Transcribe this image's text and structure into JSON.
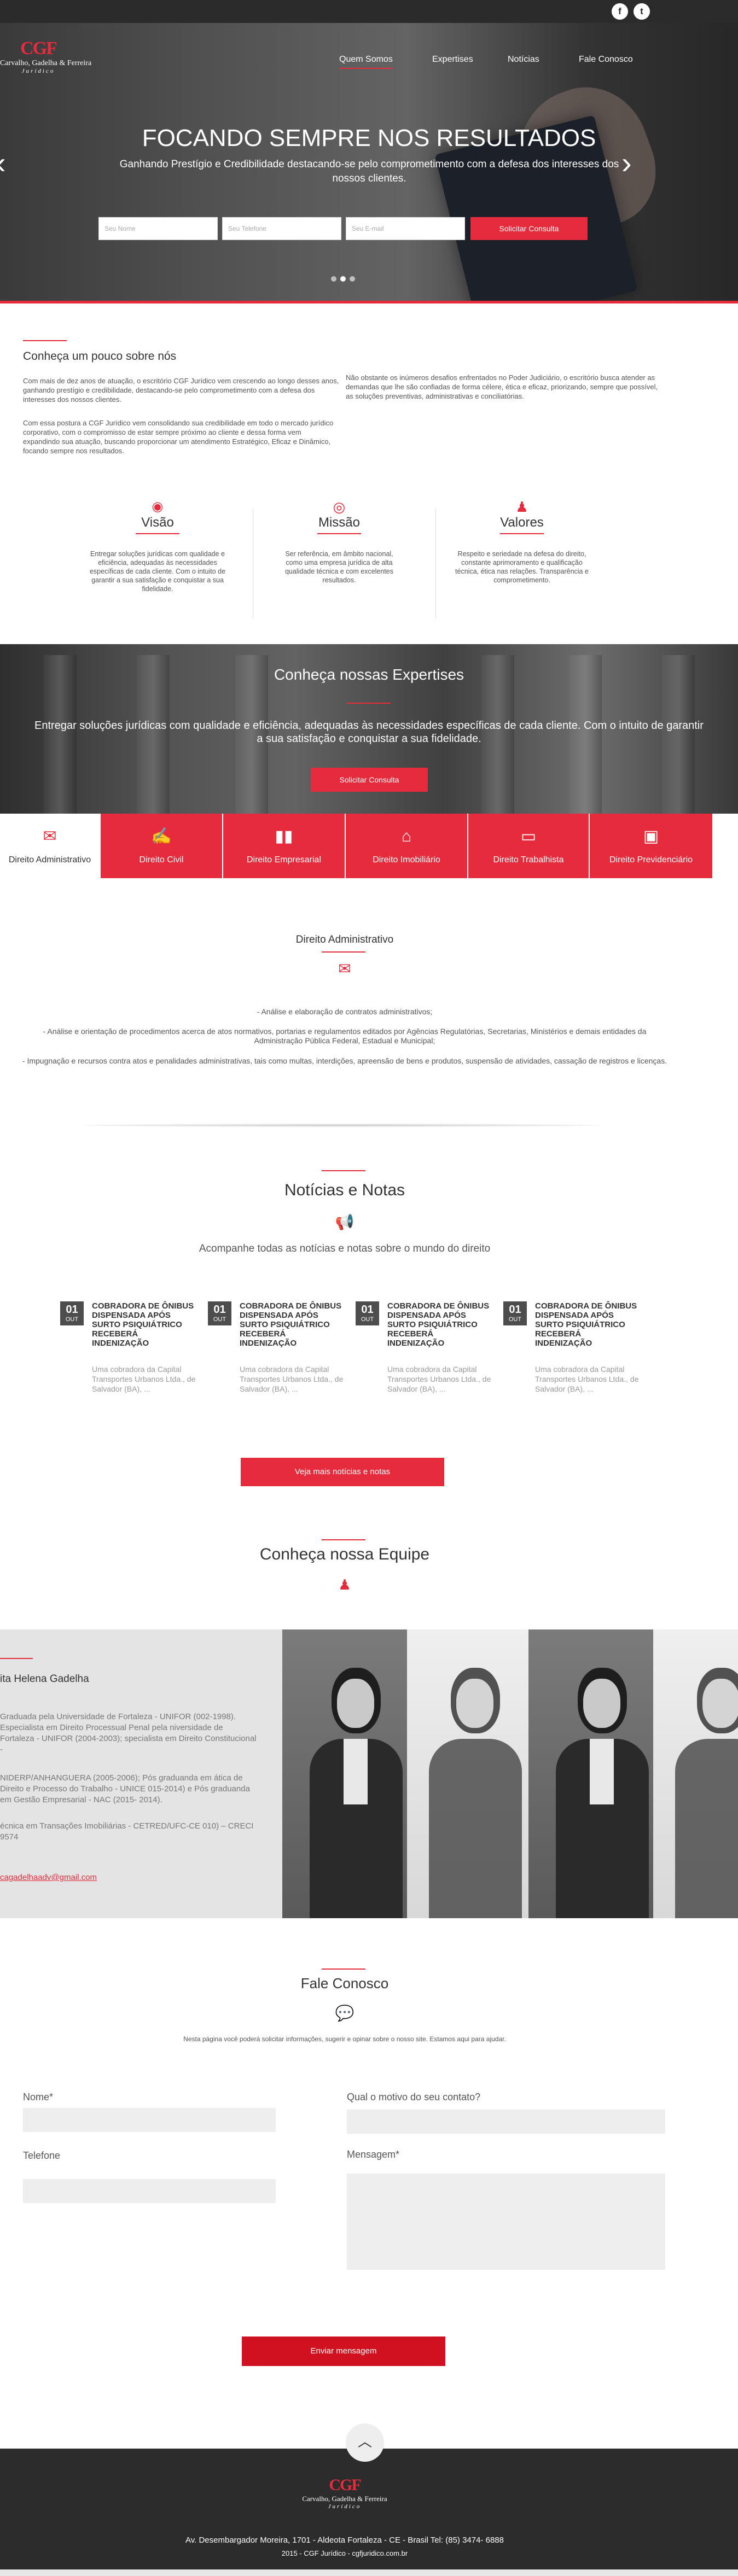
{
  "header": {
    "logo": {
      "mark": "CGF",
      "name": "Carvalho, Gadelha & Ferreira",
      "sub": "Jurídico"
    },
    "nav": [
      {
        "label": "Quem Somos",
        "active": true
      },
      {
        "label": "Expertises"
      },
      {
        "label": "Notícias"
      },
      {
        "label": "Fale Conosco"
      }
    ],
    "social": [
      {
        "icon": "facebook-icon",
        "glyph": "f"
      },
      {
        "icon": "twitter-icon",
        "glyph": "t"
      }
    ]
  },
  "hero": {
    "title": "FOCANDO SEMPRE NOS RESULTADOS",
    "subtitle": "Ganhando Prestígio e Credibilidade destacando-se pelo comprometimento com a defesa dos interesses dos nossos clientes.",
    "form": {
      "name_placeholder": "Seu Nome",
      "phone_placeholder": "Seu Telefone",
      "email_placeholder": "Seu E-mail",
      "submit": "Solicitar Consulta"
    },
    "slides": 3,
    "active_slide": 2
  },
  "about": {
    "title": "Conheça um pouco sobre nós",
    "p1": "Com mais de dez anos de atuação, o escritório CGF Jurídico vem crescendo ao longo desses anos, ganhando prestígio e credibilidade, destacando-se pelo comprometimento com a defesa dos interesses dos nossos clientes.",
    "p2": "Com essa postura a CGF Jurídico vem consolidando sua credibilidade em todo o mercado jurídico corporativo, com o compromisso de estar sempre próximo ao cliente e dessa forma vem expandindo sua atuação, buscando proporcionar um atendimento Estratégico, Eficaz e Dinâmico, focando sempre nos resultados.",
    "p3": "Não obstante os inúmeros desafios enfrentados no Poder Judiciário, o escritório busca atender as demandas que lhe são confiadas de forma célere, ética e eficaz, priorizando, sempre que possível, as soluções preventivas, administrativas e conciliatórias.",
    "pillars": [
      {
        "icon": "eye-icon",
        "glyph": "◉",
        "title": "Visão",
        "text": "Entregar soluções jurídicas com qualidade e eficiência, adequadas às necessidades específicas de cada cliente. Com o intuito de garantir a sua satisfação e conquistar a sua fidelidade."
      },
      {
        "icon": "target-icon",
        "glyph": "◎",
        "title": "Missão",
        "text": "Ser referência, em âmbito nacional, como uma empresa jurídica de alta qualidade técnica e com excelentes resultados."
      },
      {
        "icon": "people-icon",
        "glyph": "♟",
        "title": "Valores",
        "text": "Respeito e seriedade na defesa do direito, constante aprimoramento e qualificação técnica, ética nas relações. Transparência e comprometimento."
      }
    ]
  },
  "expertise": {
    "title": "Conheça nossas Expertises",
    "text": "Entregar soluções jurídicas com qualidade e eficiência, adequadas às necessidades específicas de cada cliente. Com o intuito de garantir a sua satisfação e conquistar a sua  fidelidade.",
    "cta": "Solicitar Consulta",
    "tabs": [
      {
        "label": "Direito Administrativo",
        "glyph": "✉",
        "icon": "inbox-icon",
        "selected": true
      },
      {
        "label": "Direito Civil",
        "glyph": "✍",
        "icon": "handshake-icon"
      },
      {
        "label": "Direito Empresarial",
        "glyph": "▮▮",
        "icon": "building-icon"
      },
      {
        "label": "Direito Imobiliário",
        "glyph": "⌂",
        "icon": "house-icon"
      },
      {
        "label": "Direito Trabalhista",
        "glyph": "▭",
        "icon": "briefcase-icon"
      },
      {
        "label": "Direito Previdenciário",
        "glyph": "▣",
        "icon": "document-icon"
      }
    ],
    "detail": {
      "title": "Direito Administrativo",
      "lines": [
        "- Análise e elaboração de contratos administrativos;",
        "- Análise e orientação de procedimentos acerca de atos normativos,  portarias e regulamentos editados por Agências Regulatórias, Secretarias,  Ministérios e demais entidades da Administração Pública Federal, Estadual e Municipal;",
        "- Impugnação e recursos contra atos e penalidades administrativas, tais como multas, interdições, apreensão de bens e produtos, suspensão de atividades, cassação de registros e licenças."
      ]
    }
  },
  "news": {
    "title": "Notícias e Notas",
    "subtitle": "Acompanhe todas as notícias e notas sobre o mundo do direito",
    "items": [
      {
        "day": "01",
        "month": "OUT",
        "title": "COBRADORA DE ÔNIBUS DISPENSADA APÓS SURTO PSIQUIÁTRICO RECEBERÁ INDENIZAÇÃO",
        "body": "Uma cobradora da Capital Transportes Urbanos Ltda., de Salvador (BA), ..."
      },
      {
        "day": "01",
        "month": "OUT",
        "title": "COBRADORA DE ÔNIBUS DISPENSADA APÓS SURTO PSIQUIÁTRICO RECEBERÁ INDENIZAÇÃO",
        "body": "Uma cobradora da Capital Transportes Urbanos Ltda., de Salvador (BA), ..."
      },
      {
        "day": "01",
        "month": "OUT",
        "title": "COBRADORA DE ÔNIBUS DISPENSADA APÓS SURTO PSIQUIÁTRICO RECEBERÁ INDENIZAÇÃO",
        "body": "Uma cobradora da Capital Transportes Urbanos Ltda., de Salvador (BA), ..."
      },
      {
        "day": "01",
        "month": "OUT",
        "title": "COBRADORA DE ÔNIBUS DISPENSADA APÓS SURTO PSIQUIÁTRICO RECEBERÁ INDENIZAÇÃO",
        "body": "Uma cobradora da Capital Transportes Urbanos Ltda., de Salvador (BA), ..."
      }
    ],
    "more": "Veja  mais notícias e notas"
  },
  "team": {
    "title": "Conheça nossa Equipe",
    "member": {
      "name": "ita Helena Gadelha",
      "bio1": "Graduada pela Universidade de Fortaleza - UNIFOR (002-1998). Especialista em Direito  Processual Penal pela niversidade de Fortaleza - UNIFOR (2004-2003); specialista em Direito Constitucional -",
      "bio2": "NIDERP/ANHANGUERA (2005-2006); Pós graduanda em ática de Direito e Processo do Trabalho - UNICE 015-2014) e Pós graduanda em Gestão Empresarial - NAC (2015- 2014).",
      "bio3": "écnica em Transações Imobiliárias - CETRED/UFC-CE 010) – CRECI 9574",
      "email": "cagadelhaadv@gmail.com"
    }
  },
  "contact": {
    "title": "Fale Conosco",
    "intro": "Nesta página você poderá solicitar informações, sugerir e opinar sobre o nosso site. Estamos aqui para ajudar.",
    "name_label": "Nome*",
    "phone_label": "Telefone",
    "reason_label": "Qual o motivo do seu contato?",
    "message_label": "Mensagem*",
    "submit": "Enviar mensagem"
  },
  "footer": {
    "address": "Av. Desembargador Moreira, 1701 - Aldeota Fortaleza - CE - Brasil Tel: (85) 3474- 6888",
    "copyright": "2015 - CGF Jurídico - cgfjuridico.com.br"
  },
  "colors": {
    "accent": "#e52b3c",
    "dark": "#2b2b2b"
  }
}
